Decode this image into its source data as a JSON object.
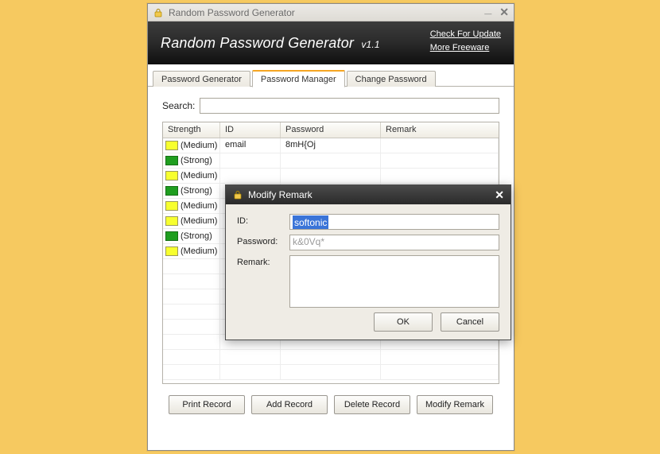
{
  "titlebar": {
    "title": "Random Password Generator"
  },
  "header": {
    "app_title": "Random Password Generator",
    "version": "v1.1",
    "link_update": "Check For Update",
    "link_freeware": "More Freeware"
  },
  "tabs": {
    "generator": "Password Generator",
    "manager": "Password Manager",
    "change": "Change Password"
  },
  "search": {
    "label": "Search:"
  },
  "table": {
    "headers": {
      "strength": "Strength",
      "id": "ID",
      "password": "Password",
      "remark": "Remark"
    },
    "rows": [
      {
        "strength_class": "medium",
        "strength": "(Medium)",
        "id": "email",
        "password": "8mH{Oj",
        "remark": ""
      },
      {
        "strength_class": "strong",
        "strength": "(Strong)",
        "id": "",
        "password": "",
        "remark": ""
      },
      {
        "strength_class": "medium",
        "strength": "(Medium)",
        "id": "",
        "password": "",
        "remark": ""
      },
      {
        "strength_class": "strong",
        "strength": "(Strong)",
        "id": "",
        "password": "",
        "remark": ""
      },
      {
        "strength_class": "medium",
        "strength": "(Medium)",
        "id": "",
        "password": "",
        "remark": ""
      },
      {
        "strength_class": "medium",
        "strength": "(Medium)",
        "id": "",
        "password": "",
        "remark": ""
      },
      {
        "strength_class": "strong",
        "strength": "(Strong)",
        "id": "",
        "password": "",
        "remark": ""
      },
      {
        "strength_class": "medium",
        "strength": "(Medium)",
        "id": "",
        "password": "",
        "remark": ""
      }
    ]
  },
  "buttons": {
    "print": "Print Record",
    "add": "Add Record",
    "delete": "Delete Record",
    "modify": "Modify Remark"
  },
  "modal": {
    "title": "Modify Remark",
    "labels": {
      "id": "ID:",
      "password": "Password:",
      "remark": "Remark:"
    },
    "values": {
      "id": "softonic",
      "password": "k&0Vq*",
      "remark": ""
    },
    "ok": "OK",
    "cancel": "Cancel"
  }
}
